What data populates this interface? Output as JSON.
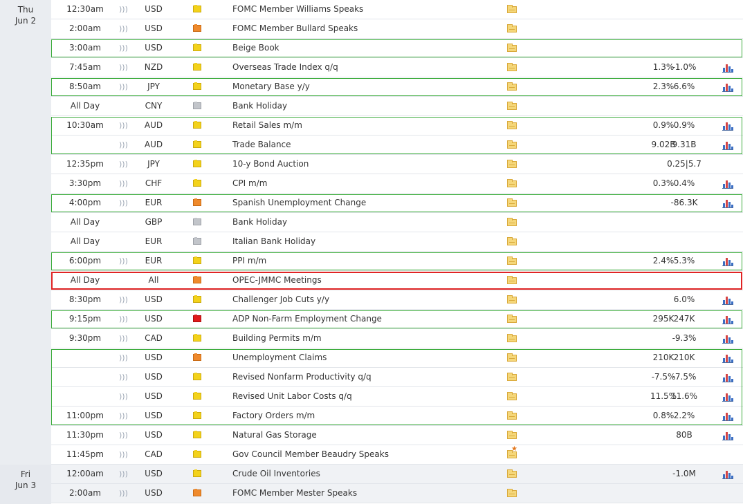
{
  "days": [
    {
      "dow": "Thu",
      "date": "Jun 2"
    },
    {
      "dow": "Fri",
      "date": "Jun 3"
    }
  ],
  "colors": {
    "impact_yellow": "#f3d21b",
    "impact_orange": "#ef8a2c",
    "impact_red": "#e01b1b",
    "impact_grey": "#c2c5ca",
    "group_border": "#3aab3a",
    "highlight_border": "#e02424",
    "folder": "#f5d77a"
  },
  "icons": {
    "volatility": "volatility-icon",
    "folder": "folder-icon",
    "folder_star": "folder-star-icon",
    "chart": "chart-icon"
  },
  "groups": [
    {
      "first": 2,
      "last": 2,
      "style": "green"
    },
    {
      "first": 4,
      "last": 4,
      "style": "green"
    },
    {
      "first": 6,
      "last": 7,
      "style": "green"
    },
    {
      "first": 10,
      "last": 10,
      "style": "green"
    },
    {
      "first": 13,
      "last": 13,
      "style": "green"
    },
    {
      "first": 14,
      "last": 14,
      "style": "red"
    },
    {
      "first": 16,
      "last": 16,
      "style": "green"
    },
    {
      "first": 18,
      "last": 21,
      "style": "green"
    }
  ],
  "rows": [
    {
      "day": 0,
      "time": "12:30am",
      "vol": true,
      "cur": "USD",
      "impact": "yellow",
      "event": "FOMC Member Williams Speaks",
      "folder": "plain",
      "actual": "",
      "forecast": "",
      "previous": "",
      "chart": false
    },
    {
      "day": 0,
      "time": "2:00am",
      "vol": true,
      "cur": "USD",
      "impact": "orange",
      "event": "FOMC Member Bullard Speaks",
      "folder": "plain",
      "actual": "",
      "forecast": "",
      "previous": "",
      "chart": false
    },
    {
      "day": 0,
      "time": "3:00am",
      "vol": true,
      "cur": "USD",
      "impact": "yellow",
      "event": "Beige Book",
      "folder": "plain",
      "actual": "",
      "forecast": "",
      "previous": "",
      "chart": false
    },
    {
      "day": 0,
      "time": "7:45am",
      "vol": true,
      "cur": "NZD",
      "impact": "yellow",
      "event": "Overseas Trade Index q/q",
      "folder": "plain",
      "actual": "",
      "forecast": "1.3%",
      "previous": "-1.0%",
      "chart": true
    },
    {
      "day": 0,
      "time": "8:50am",
      "vol": true,
      "cur": "JPY",
      "impact": "yellow",
      "event": "Monetary Base y/y",
      "folder": "plain",
      "actual": "",
      "forecast": "2.3%",
      "previous": "6.6%",
      "chart": true
    },
    {
      "day": 0,
      "time": "All Day",
      "vol": false,
      "cur": "CNY",
      "impact": "grey",
      "event": "Bank Holiday",
      "folder": "plain",
      "actual": "",
      "forecast": "",
      "previous": "",
      "chart": false
    },
    {
      "day": 0,
      "time": "10:30am",
      "vol": true,
      "cur": "AUD",
      "impact": "yellow",
      "event": "Retail Sales m/m",
      "folder": "plain",
      "actual": "",
      "forecast": "0.9%",
      "previous": "0.9%",
      "chart": true
    },
    {
      "day": 0,
      "time": "",
      "vol": true,
      "cur": "AUD",
      "impact": "yellow",
      "event": "Trade Balance",
      "folder": "plain",
      "actual": "",
      "forecast": "9.02B",
      "previous": "9.31B",
      "chart": true
    },
    {
      "day": 0,
      "time": "12:35pm",
      "vol": true,
      "cur": "JPY",
      "impact": "yellow",
      "event": "10-y Bond Auction",
      "folder": "plain",
      "actual": "",
      "forecast": "",
      "previous": "0.25|5.7",
      "chart": false
    },
    {
      "day": 0,
      "time": "3:30pm",
      "vol": true,
      "cur": "CHF",
      "impact": "yellow",
      "event": "CPI m/m",
      "folder": "plain",
      "actual": "",
      "forecast": "0.3%",
      "previous": "0.4%",
      "chart": true
    },
    {
      "day": 0,
      "time": "4:00pm",
      "vol": true,
      "cur": "EUR",
      "impact": "orange",
      "event": "Spanish Unemployment Change",
      "folder": "plain",
      "actual": "",
      "forecast": "",
      "previous": "-86.3K",
      "chart": true
    },
    {
      "day": 0,
      "time": "All Day",
      "vol": false,
      "cur": "GBP",
      "impact": "grey",
      "event": "Bank Holiday",
      "folder": "plain",
      "actual": "",
      "forecast": "",
      "previous": "",
      "chart": false
    },
    {
      "day": 0,
      "time": "All Day",
      "vol": false,
      "cur": "EUR",
      "impact": "grey",
      "event": "Italian Bank Holiday",
      "folder": "plain",
      "actual": "",
      "forecast": "",
      "previous": "",
      "chart": false
    },
    {
      "day": 0,
      "time": "6:00pm",
      "vol": true,
      "cur": "EUR",
      "impact": "yellow",
      "event": "PPI m/m",
      "folder": "plain",
      "actual": "",
      "forecast": "2.4%",
      "previous": "5.3%",
      "chart": true
    },
    {
      "day": 0,
      "time": "All Day",
      "vol": false,
      "cur": "All",
      "impact": "orange",
      "event": "OPEC-JMMC Meetings",
      "folder": "plain",
      "actual": "",
      "forecast": "",
      "previous": "",
      "chart": false
    },
    {
      "day": 0,
      "time": "8:30pm",
      "vol": true,
      "cur": "USD",
      "impact": "yellow",
      "event": "Challenger Job Cuts y/y",
      "folder": "plain",
      "actual": "",
      "forecast": "",
      "previous": "6.0%",
      "chart": true
    },
    {
      "day": 0,
      "time": "9:15pm",
      "vol": true,
      "cur": "USD",
      "impact": "red",
      "event": "ADP Non-Farm Employment Change",
      "folder": "plain",
      "actual": "",
      "forecast": "295K",
      "previous": "247K",
      "chart": true
    },
    {
      "day": 0,
      "time": "9:30pm",
      "vol": true,
      "cur": "CAD",
      "impact": "yellow",
      "event": "Building Permits m/m",
      "folder": "plain",
      "actual": "",
      "forecast": "",
      "previous": "-9.3%",
      "chart": true
    },
    {
      "day": 0,
      "time": "",
      "vol": true,
      "cur": "USD",
      "impact": "orange",
      "event": "Unemployment Claims",
      "folder": "plain",
      "actual": "",
      "forecast": "210K",
      "previous": "210K",
      "chart": true
    },
    {
      "day": 0,
      "time": "",
      "vol": true,
      "cur": "USD",
      "impact": "yellow",
      "event": "Revised Nonfarm Productivity q/q",
      "folder": "plain",
      "actual": "",
      "forecast": "-7.5%",
      "previous": "-7.5%",
      "chart": true
    },
    {
      "day": 0,
      "time": "",
      "vol": true,
      "cur": "USD",
      "impact": "yellow",
      "event": "Revised Unit Labor Costs q/q",
      "folder": "plain",
      "actual": "",
      "forecast": "11.5%",
      "previous": "11.6%",
      "chart": true
    },
    {
      "day": 0,
      "time": "11:00pm",
      "vol": true,
      "cur": "USD",
      "impact": "yellow",
      "event": "Factory Orders m/m",
      "folder": "plain",
      "actual": "",
      "forecast": "0.8%",
      "previous": "2.2%",
      "chart": true
    },
    {
      "day": 0,
      "time": "11:30pm",
      "vol": true,
      "cur": "USD",
      "impact": "yellow",
      "event": "Natural Gas Storage",
      "folder": "plain",
      "actual": "",
      "forecast": "",
      "previous": "80B",
      "chart": true
    },
    {
      "day": 0,
      "time": "11:45pm",
      "vol": true,
      "cur": "CAD",
      "impact": "yellow",
      "event": "Gov Council Member Beaudry Speaks",
      "folder": "star",
      "actual": "",
      "forecast": "",
      "previous": "",
      "chart": false
    },
    {
      "day": 1,
      "time": "12:00am",
      "vol": true,
      "cur": "USD",
      "impact": "yellow",
      "event": "Crude Oil Inventories",
      "folder": "plain",
      "actual": "",
      "forecast": "",
      "previous": "-1.0M",
      "chart": true
    },
    {
      "day": 1,
      "time": "2:00am",
      "vol": true,
      "cur": "USD",
      "impact": "orange",
      "event": "FOMC Member Mester Speaks",
      "folder": "plain",
      "actual": "",
      "forecast": "",
      "previous": "",
      "chart": false
    }
  ]
}
